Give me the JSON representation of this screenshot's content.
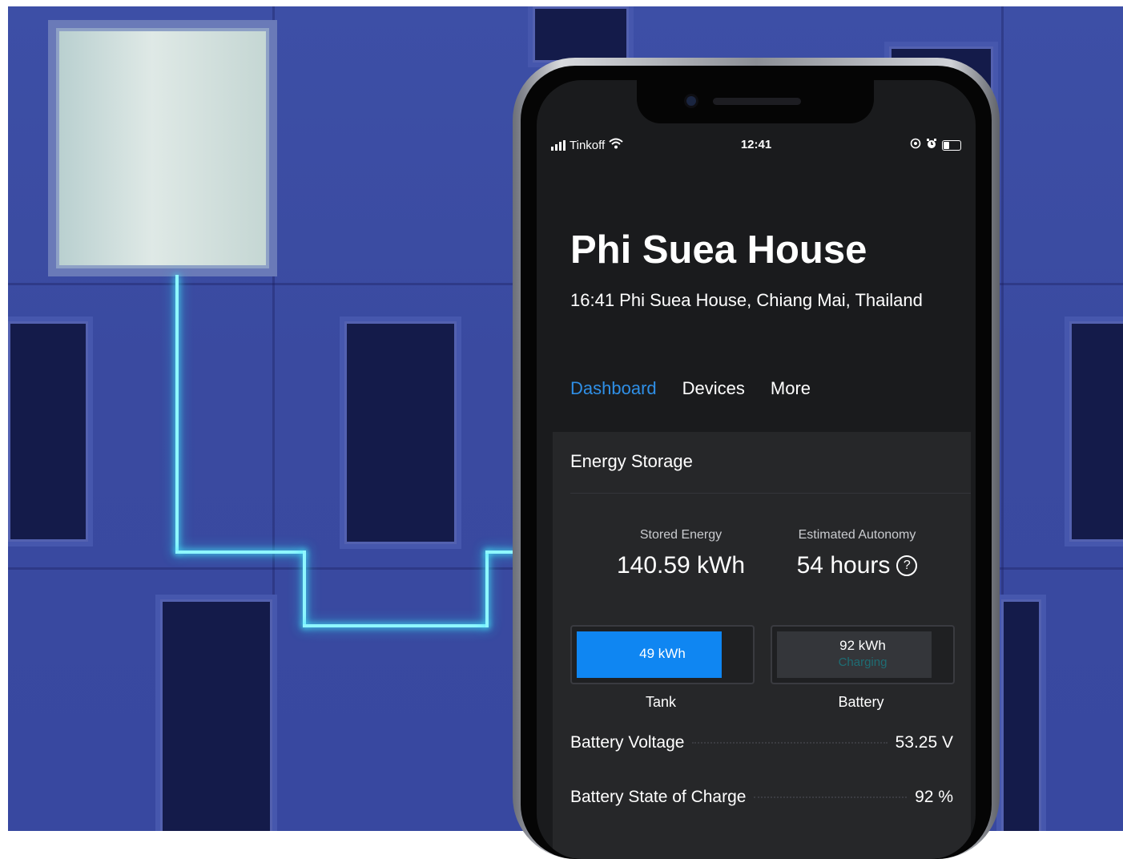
{
  "status_bar": {
    "carrier": "Tinkoff",
    "time": "12:41"
  },
  "header": {
    "title": "Phi Suea House",
    "subtitle": "16:41 Phi Suea House, Chiang Mai, Thailand"
  },
  "tabs": [
    {
      "label": "Dashboard",
      "active": true
    },
    {
      "label": "Devices",
      "active": false
    },
    {
      "label": "More",
      "active": false
    }
  ],
  "energy_storage": {
    "title": "Energy Storage",
    "stored_energy": {
      "label": "Stored Energy",
      "value": "140.59 kWh"
    },
    "autonomy": {
      "label": "Estimated Autonomy",
      "value": "54 hours",
      "help_glyph": "?"
    },
    "tank": {
      "value": "49 kWh",
      "caption": "Tank",
      "fill_fraction": 0.86,
      "color": "#0f86f2"
    },
    "battery": {
      "value": "92 kWh",
      "status": "Charging",
      "caption": "Battery",
      "fill_fraction": 0.92,
      "color": "#34363a",
      "status_color": "#1e6d74"
    },
    "rows": [
      {
        "label": "Battery Voltage",
        "value": "53.25 V"
      },
      {
        "label": "Battery State of Charge",
        "value": "92 %"
      }
    ]
  },
  "colors": {
    "accent": "#2f8fe6",
    "glow": "#8ff7ff"
  }
}
